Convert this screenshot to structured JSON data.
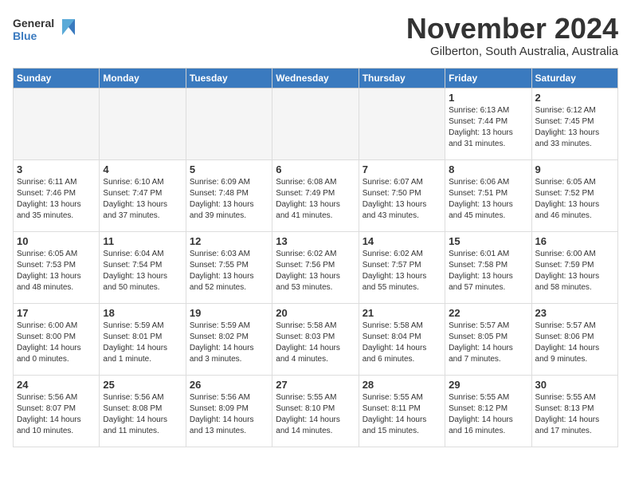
{
  "header": {
    "logo_general": "General",
    "logo_blue": "Blue",
    "month_title": "November 2024",
    "location": "Gilberton, South Australia, Australia"
  },
  "days_of_week": [
    "Sunday",
    "Monday",
    "Tuesday",
    "Wednesday",
    "Thursday",
    "Friday",
    "Saturday"
  ],
  "weeks": [
    [
      {
        "day": "",
        "empty": true
      },
      {
        "day": "",
        "empty": true
      },
      {
        "day": "",
        "empty": true
      },
      {
        "day": "",
        "empty": true
      },
      {
        "day": "",
        "empty": true
      },
      {
        "day": "1",
        "sunrise": "6:13 AM",
        "sunset": "7:44 PM",
        "daylight": "13 hours and 31 minutes."
      },
      {
        "day": "2",
        "sunrise": "6:12 AM",
        "sunset": "7:45 PM",
        "daylight": "13 hours and 33 minutes."
      }
    ],
    [
      {
        "day": "3",
        "sunrise": "6:11 AM",
        "sunset": "7:46 PM",
        "daylight": "13 hours and 35 minutes."
      },
      {
        "day": "4",
        "sunrise": "6:10 AM",
        "sunset": "7:47 PM",
        "daylight": "13 hours and 37 minutes."
      },
      {
        "day": "5",
        "sunrise": "6:09 AM",
        "sunset": "7:48 PM",
        "daylight": "13 hours and 39 minutes."
      },
      {
        "day": "6",
        "sunrise": "6:08 AM",
        "sunset": "7:49 PM",
        "daylight": "13 hours and 41 minutes."
      },
      {
        "day": "7",
        "sunrise": "6:07 AM",
        "sunset": "7:50 PM",
        "daylight": "13 hours and 43 minutes."
      },
      {
        "day": "8",
        "sunrise": "6:06 AM",
        "sunset": "7:51 PM",
        "daylight": "13 hours and 45 minutes."
      },
      {
        "day": "9",
        "sunrise": "6:05 AM",
        "sunset": "7:52 PM",
        "daylight": "13 hours and 46 minutes."
      }
    ],
    [
      {
        "day": "10",
        "sunrise": "6:05 AM",
        "sunset": "7:53 PM",
        "daylight": "13 hours and 48 minutes."
      },
      {
        "day": "11",
        "sunrise": "6:04 AM",
        "sunset": "7:54 PM",
        "daylight": "13 hours and 50 minutes."
      },
      {
        "day": "12",
        "sunrise": "6:03 AM",
        "sunset": "7:55 PM",
        "daylight": "13 hours and 52 minutes."
      },
      {
        "day": "13",
        "sunrise": "6:02 AM",
        "sunset": "7:56 PM",
        "daylight": "13 hours and 53 minutes."
      },
      {
        "day": "14",
        "sunrise": "6:02 AM",
        "sunset": "7:57 PM",
        "daylight": "13 hours and 55 minutes."
      },
      {
        "day": "15",
        "sunrise": "6:01 AM",
        "sunset": "7:58 PM",
        "daylight": "13 hours and 57 minutes."
      },
      {
        "day": "16",
        "sunrise": "6:00 AM",
        "sunset": "7:59 PM",
        "daylight": "13 hours and 58 minutes."
      }
    ],
    [
      {
        "day": "17",
        "sunrise": "6:00 AM",
        "sunset": "8:00 PM",
        "daylight": "14 hours and 0 minutes."
      },
      {
        "day": "18",
        "sunrise": "5:59 AM",
        "sunset": "8:01 PM",
        "daylight": "14 hours and 1 minute."
      },
      {
        "day": "19",
        "sunrise": "5:59 AM",
        "sunset": "8:02 PM",
        "daylight": "14 hours and 3 minutes."
      },
      {
        "day": "20",
        "sunrise": "5:58 AM",
        "sunset": "8:03 PM",
        "daylight": "14 hours and 4 minutes."
      },
      {
        "day": "21",
        "sunrise": "5:58 AM",
        "sunset": "8:04 PM",
        "daylight": "14 hours and 6 minutes."
      },
      {
        "day": "22",
        "sunrise": "5:57 AM",
        "sunset": "8:05 PM",
        "daylight": "14 hours and 7 minutes."
      },
      {
        "day": "23",
        "sunrise": "5:57 AM",
        "sunset": "8:06 PM",
        "daylight": "14 hours and 9 minutes."
      }
    ],
    [
      {
        "day": "24",
        "sunrise": "5:56 AM",
        "sunset": "8:07 PM",
        "daylight": "14 hours and 10 minutes."
      },
      {
        "day": "25",
        "sunrise": "5:56 AM",
        "sunset": "8:08 PM",
        "daylight": "14 hours and 11 minutes."
      },
      {
        "day": "26",
        "sunrise": "5:56 AM",
        "sunset": "8:09 PM",
        "daylight": "14 hours and 13 minutes."
      },
      {
        "day": "27",
        "sunrise": "5:55 AM",
        "sunset": "8:10 PM",
        "daylight": "14 hours and 14 minutes."
      },
      {
        "day": "28",
        "sunrise": "5:55 AM",
        "sunset": "8:11 PM",
        "daylight": "14 hours and 15 minutes."
      },
      {
        "day": "29",
        "sunrise": "5:55 AM",
        "sunset": "8:12 PM",
        "daylight": "14 hours and 16 minutes."
      },
      {
        "day": "30",
        "sunrise": "5:55 AM",
        "sunset": "8:13 PM",
        "daylight": "14 hours and 17 minutes."
      }
    ]
  ]
}
